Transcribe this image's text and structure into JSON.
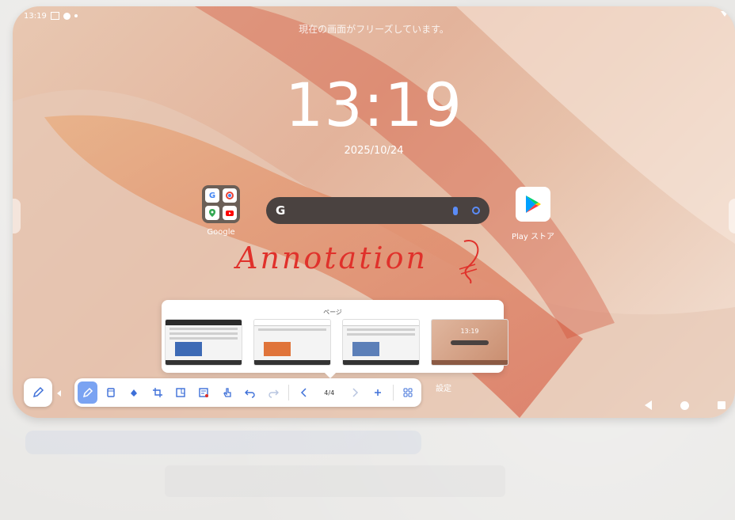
{
  "status_bar": {
    "time": "13:19"
  },
  "lock": {
    "freeze_message": "現在の画面がフリーズしています。",
    "clock": "13:19",
    "date": "2025/10/24"
  },
  "apps": [
    {
      "label": "Google"
    },
    {
      "label": "Play ストア"
    }
  ],
  "annotation_text": "Annotation",
  "pages_panel": {
    "title": "ページ",
    "thumb_clock": "13:19"
  },
  "settings_label": "設定",
  "toolbar": {
    "page_indicator": "4/4"
  },
  "colors": {
    "accent": "#3d6fd8",
    "annotation": "#e0312b",
    "active_tool": "#7aa3f2"
  },
  "icons": [
    "pen-icon",
    "eraser-icon",
    "fill-icon",
    "crop-icon",
    "page-icon",
    "note-icon",
    "hand-icon",
    "undo-icon",
    "redo-icon",
    "prev-icon",
    "next-icon",
    "add-icon",
    "grid-icon",
    "back-icon",
    "home-icon",
    "recent-icon"
  ]
}
